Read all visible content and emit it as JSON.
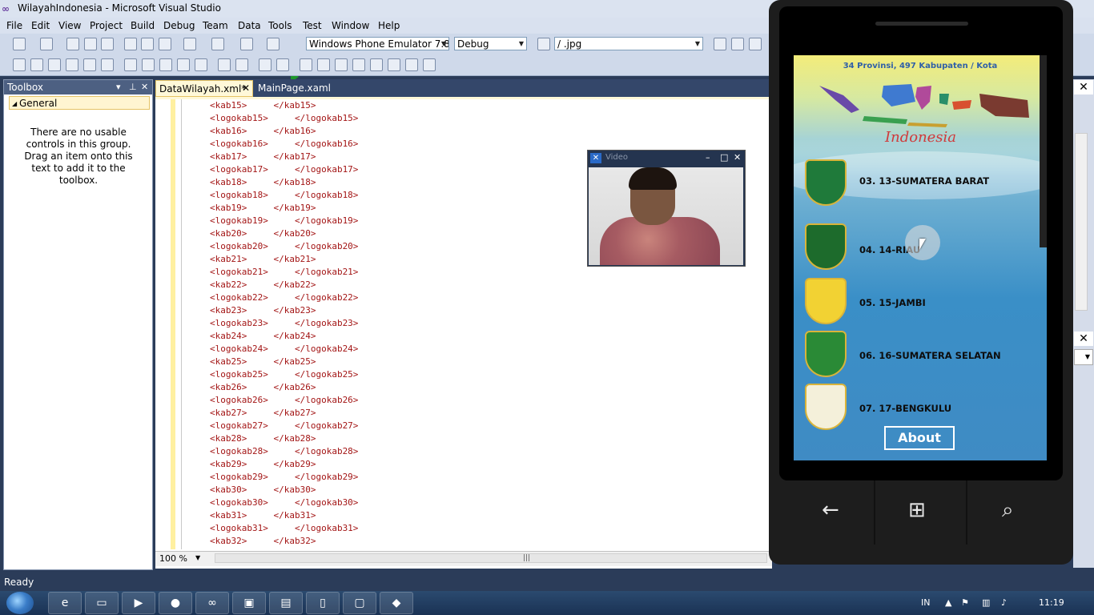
{
  "window": {
    "title": "WilayahIndonesia - Microsoft Visual Studio"
  },
  "menu": [
    "File",
    "Edit",
    "View",
    "Project",
    "Build",
    "Debug",
    "Team",
    "Data",
    "Tools",
    "Test",
    "Window",
    "Help"
  ],
  "toolbar": {
    "target_device": "Windows Phone Emulator 7.8 2",
    "configuration": "Debug",
    "find_value": "/ .jpg"
  },
  "toolbox": {
    "title": "Toolbox",
    "group": "General",
    "empty_message": "There are no usable controls in this group. Drag an item onto this text to add it to the toolbox."
  },
  "tabs": [
    {
      "label": "DataWilayah.xml*",
      "active": true
    },
    {
      "label": "MainPage.xaml",
      "active": false
    }
  ],
  "code_lines": [
    "<kab15>     </kab15>",
    "<logokab15>     </logokab15>",
    "<kab16>     </kab16>",
    "<logokab16>     </logokab16>",
    "<kab17>     </kab17>",
    "<logokab17>     </logokab17>",
    "<kab18>     </kab18>",
    "<logokab18>     </logokab18>",
    "<kab19>     </kab19>",
    "<logokab19>     </logokab19>",
    "<kab20>     </kab20>",
    "<logokab20>     </logokab20>",
    "<kab21>     </kab21>",
    "<logokab21>     </logokab21>",
    "<kab22>     </kab22>",
    "<logokab22>     </logokab22>",
    "<kab23>     </kab23>",
    "<logokab23>     </logokab23>",
    "<kab24>     </kab24>",
    "<logokab24>     </logokab24>",
    "<kab25>     </kab25>",
    "<logokab25>     </logokab25>",
    "<kab26>     </kab26>",
    "<logokab26>     </logokab26>",
    "<kab27>     </kab27>",
    "<logokab27>     </logokab27>",
    "<kab28>     </kab28>",
    "<logokab28>     </logokab28>",
    "<kab29>     </kab29>",
    "<logokab29>     </logokab29>",
    "<kab30>     </kab30>",
    "<logokab30>     </logokab30>",
    "<kab31>     </kab31>",
    "<logokab31>     </logokab31>",
    "<kab32>     </kab32>"
  ],
  "editor": {
    "zoom": "100 %"
  },
  "video": {
    "title": "Video"
  },
  "phone_app": {
    "header": "34 Provinsi, 497 Kabupaten / Kota",
    "brand": "Indonesia",
    "provinces": [
      {
        "label": "03. 13-SUMATERA BARAT",
        "logo_color": "#1f7a3a"
      },
      {
        "label": "04. 14-RIAU",
        "logo_color": "#1d6b2c"
      },
      {
        "label": "05. 15-JAMBI",
        "logo_color": "#f2d233"
      },
      {
        "label": "06. 16-SUMATERA SELATAN",
        "logo_color": "#2a8a36"
      },
      {
        "label": "07. 17-BENGKULU",
        "logo_color": "#f4f0da"
      }
    ],
    "about_label": "About"
  },
  "status": "Ready",
  "taskbar": {
    "items": [
      "ie-icon",
      "explorer-icon",
      "media-player-icon",
      "firefox-icon",
      "visual-studio-icon",
      "task-manager-icon",
      "window-icon",
      "phone-icon",
      "video-icon",
      "app-icon"
    ],
    "language": "IN",
    "clock": "11:19"
  }
}
